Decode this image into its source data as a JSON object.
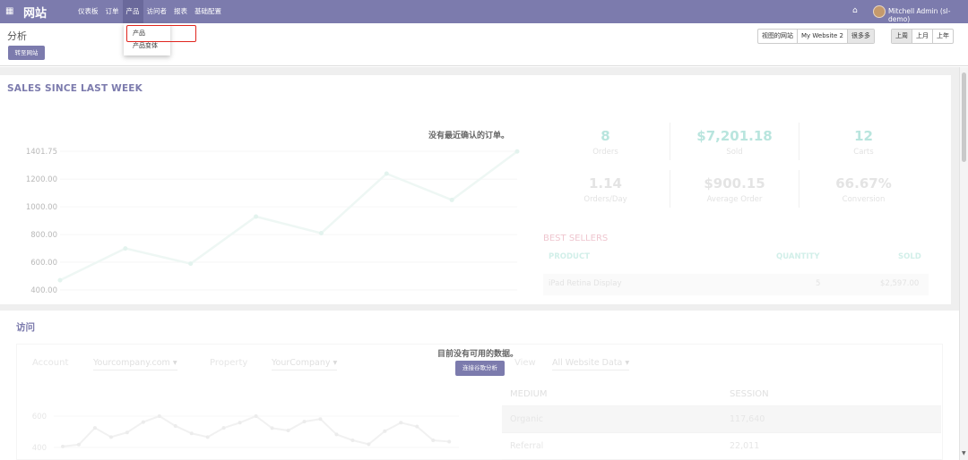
{
  "navbar": {
    "apps_icon": "apps-grid-icon",
    "brand": "网站",
    "menu": [
      "仪表板",
      "订单",
      "产品",
      "访问者",
      "报表",
      "基础配置"
    ],
    "active_menu": "产品",
    "home_icon": "home-icon",
    "user": "Mitchell Admin (sl-demo)"
  },
  "dropdown": {
    "items": [
      "产品",
      "产品变体"
    ],
    "highlighted": "产品"
  },
  "control_panel": {
    "title": "分析",
    "go_button": "转至网站",
    "website_filter": [
      "视图的网站",
      "My Website 2",
      "很多多"
    ],
    "website_selected": "很多多",
    "period_filter": [
      "上周",
      "上月",
      "上年"
    ]
  },
  "sales": {
    "title": "SALES SINCE LAST WEEK",
    "no_data": "没有最近确认的订单。",
    "stats": [
      {
        "value": "8",
        "label": "Orders"
      },
      {
        "value": "$7,201.18",
        "label": "Sold"
      },
      {
        "value": "12",
        "label": "Carts"
      },
      {
        "value": "1.14",
        "label": "Orders/Day"
      },
      {
        "value": "$900.15",
        "label": "Average Order"
      },
      {
        "value": "66.67%",
        "label": "Conversion"
      }
    ],
    "best_sellers": {
      "title": "BEST SELLERS",
      "columns": [
        "PRODUCT",
        "QUANTITY",
        "SOLD"
      ],
      "rows": [
        {
          "product": "iPad Retina Display",
          "quantity": "5",
          "sold": "$2,597.00"
        }
      ]
    }
  },
  "chart_data": [
    {
      "type": "line",
      "title": "",
      "xlabel": "",
      "ylabel": "",
      "y_ticks": [
        "1401.75",
        "1200.00",
        "1000.00",
        "800.00",
        "600.00",
        "400.00"
      ],
      "ylim": [
        400,
        1401.75
      ],
      "series": [
        {
          "values": [
            470,
            700,
            590,
            930,
            810,
            1240,
            1050,
            1400
          ]
        }
      ],
      "line_color": "#eef7f4"
    },
    {
      "type": "line",
      "title": "",
      "y_ticks": [
        "600",
        "400"
      ],
      "ylim": [
        300,
        600
      ],
      "series": [
        {
          "values": [
            392,
            378,
            250,
            320,
            285,
            205,
            160,
            235,
            292,
            320,
            250,
            210,
            160,
            252,
            270,
            202,
            182,
            300,
            345,
            375,
            275,
            210,
            240,
            345,
            355
          ]
        }
      ],
      "line_color": "#f1f1f1"
    }
  ],
  "visits": {
    "title": "访问",
    "no_data": "目前没有可用的数据。",
    "link_button": "连接谷歌分析",
    "account_label": "Account",
    "account_value": "Yourcompany.com",
    "property_label": "Property",
    "property_value": "YourCompany",
    "view_label": "View",
    "view_value": "All Website Data",
    "table": {
      "columns": [
        "MEDIUM",
        "SESSION"
      ],
      "rows": [
        {
          "medium": "Organic",
          "session": "117,640"
        },
        {
          "medium": "Referral",
          "session": "22,011"
        }
      ]
    }
  }
}
